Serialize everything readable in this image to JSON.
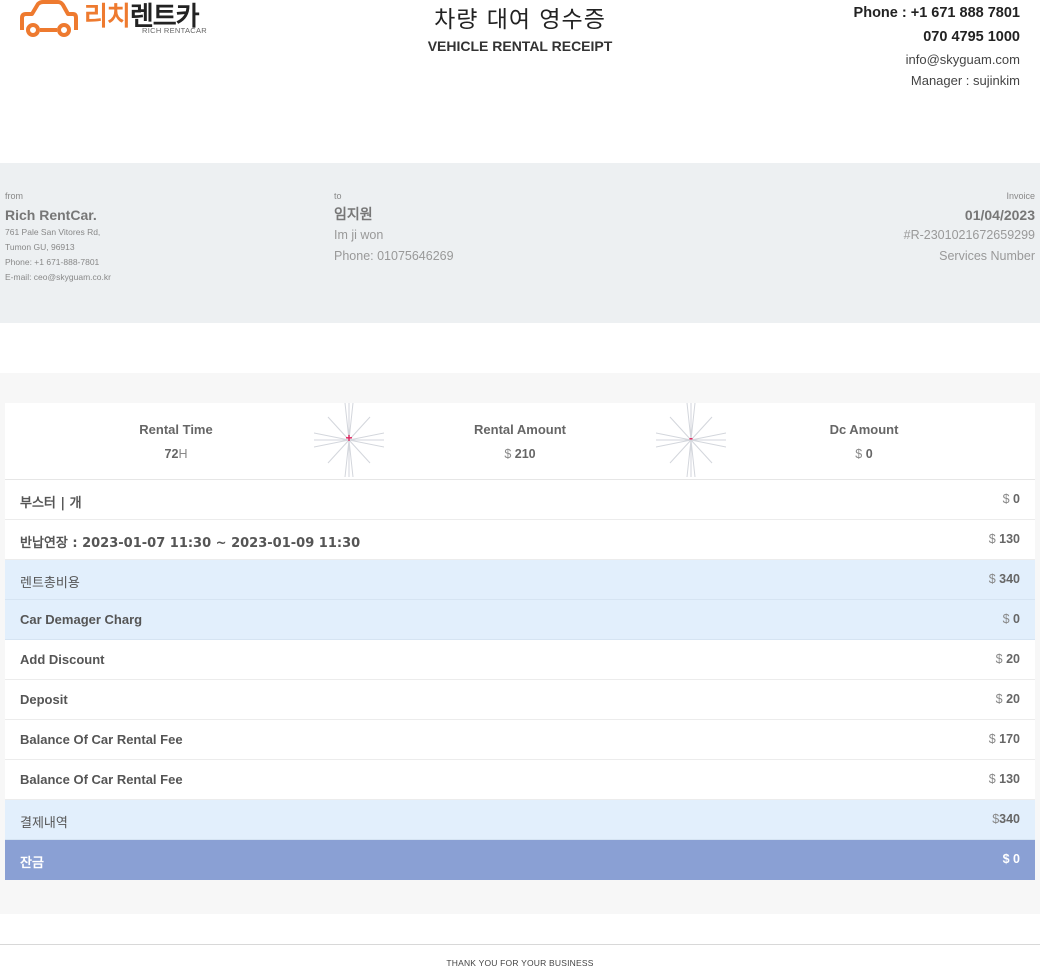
{
  "brand": {
    "name_ko_part1": "리치",
    "name_ko_part2": "렌트카",
    "name_en": "RICH RENTACAR",
    "accent_color": "#ee7a2f"
  },
  "header": {
    "title_ko": "차량 대여 영수증",
    "title_en": "VEHICLE RENTAL RECEIPT",
    "phone": "Phone : +1 671 888 7801",
    "phone_alt": "070 4795 1000",
    "email": "info@skyguam.com",
    "manager": "Manager : sujinkim"
  },
  "from": {
    "label": "from",
    "name": "Rich RentCar.",
    "address1": "761 Pale San Vitores Rd,",
    "address2": "Tumon GU, 96913",
    "phone": "Phone: +1 671-888-7801",
    "email": "E-mail: ceo@skyguam.co.kr"
  },
  "to": {
    "label": "to",
    "name_ko": "임지원",
    "name_en": "Im ji won",
    "phone": "Phone: 01075646269"
  },
  "invoice": {
    "label": "Invoice",
    "date": "01/04/2023",
    "number": "#R-2301021672659299",
    "number_label": "Services Number"
  },
  "summary": {
    "rental_time": {
      "label": "Rental Time",
      "value": "72",
      "unit": "H"
    },
    "plus_sign": "+",
    "rental_amount": {
      "label": "Rental Amount",
      "currency": "$",
      "value": "210"
    },
    "minus_sign": "-",
    "dc_amount": {
      "label": "Dc Amount",
      "currency": "$",
      "value": "0"
    }
  },
  "rows": [
    {
      "label": "부스터 | 개",
      "currency": "$",
      "amount": "0",
      "style": "normal"
    },
    {
      "label": "반납연장 : 2023-01-07 11:30 ~ 2023-01-09 11:30",
      "currency": "$",
      "amount": "130",
      "style": "normal"
    },
    {
      "label": "렌트총비용",
      "currency": "$",
      "amount": "340",
      "style": "highlight"
    },
    {
      "label": "Car Demager Charg",
      "currency": "$",
      "amount": "0",
      "style": "highlight"
    },
    {
      "label": "Add Discount",
      "currency": "$",
      "amount": "20",
      "style": "normal"
    },
    {
      "label": "Deposit",
      "currency": "$",
      "amount": "20",
      "style": "normal"
    },
    {
      "label": "Balance Of Car Rental Fee",
      "currency": "$",
      "amount": "170",
      "style": "normal"
    },
    {
      "label": "Balance Of Car Rental Fee",
      "currency": "$",
      "amount": "130",
      "style": "normal"
    },
    {
      "label": "결제내역",
      "currency": "$",
      "amount": "340",
      "style": "highlight"
    },
    {
      "label": "잔금",
      "currency": "$",
      "amount": "0",
      "style": "total"
    }
  ],
  "footer": {
    "text": "THANK YOU FOR YOUR BUSINESS"
  }
}
